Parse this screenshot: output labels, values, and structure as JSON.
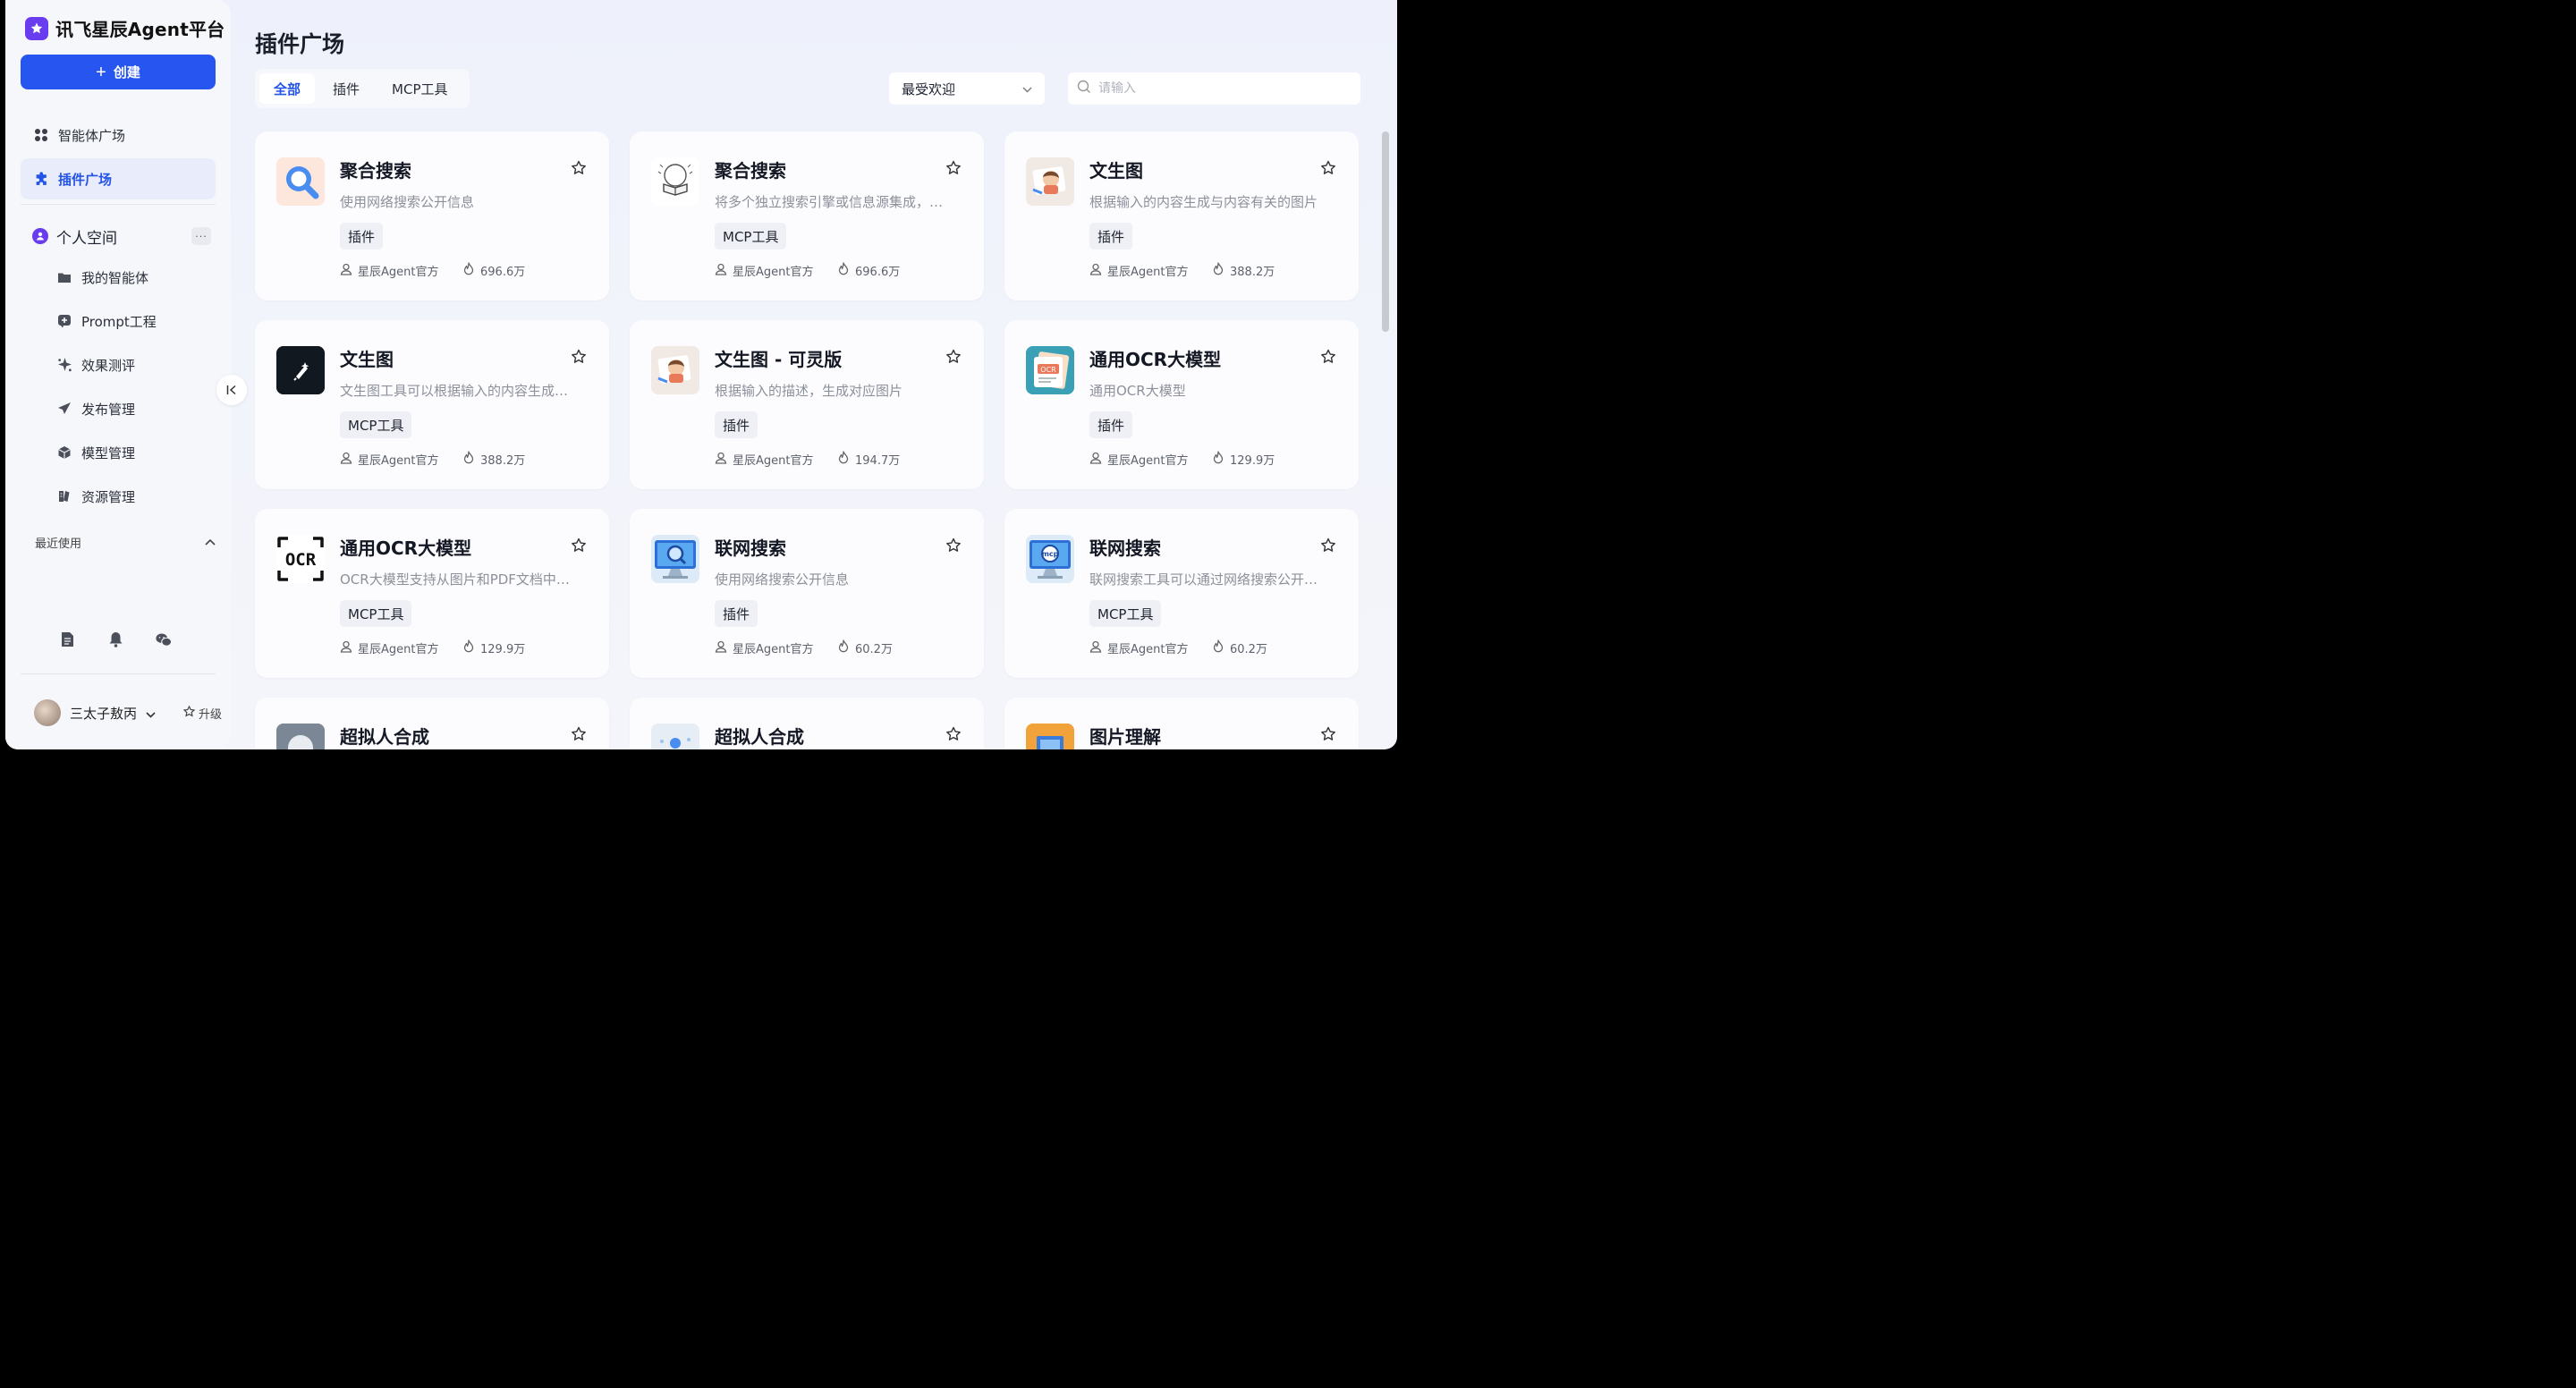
{
  "app": {
    "brand_name": "讯飞星辰Agent平台",
    "create_label": "创建"
  },
  "nav": {
    "agent_square": "智能体广场",
    "plugin_square": "插件广场",
    "personal_space": "个人空间",
    "more": "···",
    "sub_items": [
      "我的智能体",
      "Prompt工程",
      "效果测评",
      "发布管理",
      "模型管理",
      "资源管理"
    ],
    "recent": "最近使用"
  },
  "user": {
    "name": "三太子敖丙",
    "upgrade_label": "升级"
  },
  "page": {
    "title": "插件广场",
    "tabs": [
      "全部",
      "插件",
      "MCP工具"
    ],
    "sort_selected": "最受欢迎",
    "search_placeholder": "请输入"
  },
  "cards": [
    {
      "title": "聚合搜索",
      "desc": "使用网络搜索公开信息",
      "tag": "插件",
      "author": "星辰Agent官方",
      "hot": "696.6万",
      "icon": "search-magnifier-icon"
    },
    {
      "title": "聚合搜索",
      "desc": "将多个独立搜索引擎或信息源集成，…",
      "tag": "MCP工具",
      "author": "星辰Agent官方",
      "hot": "696.6万",
      "icon": "book-sketch-icon"
    },
    {
      "title": "文生图",
      "desc": "根据输入的内容生成与内容有关的图片",
      "tag": "插件",
      "author": "星辰Agent官方",
      "hot": "388.2万",
      "icon": "girl-painting-icon"
    },
    {
      "title": "文生图",
      "desc": "文生图工具可以根据输入的内容生成…",
      "tag": "MCP工具",
      "author": "星辰Agent官方",
      "hot": "388.2万",
      "icon": "sparkle-pen-icon"
    },
    {
      "title": "文生图 - 可灵版",
      "desc": "根据输入的描述，生成对应图片",
      "tag": "插件",
      "author": "星辰Agent官方",
      "hot": "194.7万",
      "icon": "girl-painting-icon"
    },
    {
      "title": "通用OCR大模型",
      "desc": "通用OCR大模型",
      "tag": "插件",
      "author": "星辰Agent官方",
      "hot": "129.9万",
      "icon": "ocr-document-icon"
    },
    {
      "title": "通用OCR大模型",
      "desc": "OCR大模型支持从图片和PDF文档中…",
      "tag": "MCP工具",
      "author": "星辰Agent官方",
      "hot": "129.9万",
      "icon": "ocr-frame-icon"
    },
    {
      "title": "联网搜索",
      "desc": "使用网络搜索公开信息",
      "tag": "插件",
      "author": "星辰Agent官方",
      "hot": "60.2万",
      "icon": "monitor-search-icon"
    },
    {
      "title": "联网搜索",
      "desc": "联网搜索工具可以通过网络搜索公开…",
      "tag": "MCP工具",
      "author": "星辰Agent官方",
      "hot": "60.2万",
      "icon": "monitor-mcp-icon"
    },
    {
      "title": "超拟人合成",
      "icon": "avatar-sphere-icon"
    },
    {
      "title": "超拟人合成",
      "icon": "figure-scene-icon"
    },
    {
      "title": "图片理解",
      "icon": "image-frame-icon"
    }
  ],
  "ocr_label": "OCR",
  "mcp_label": "mcp",
  "colors": {
    "accent": "#2453e8",
    "create_button": "#2755f0",
    "brand_purple": "#6a3cf0"
  }
}
